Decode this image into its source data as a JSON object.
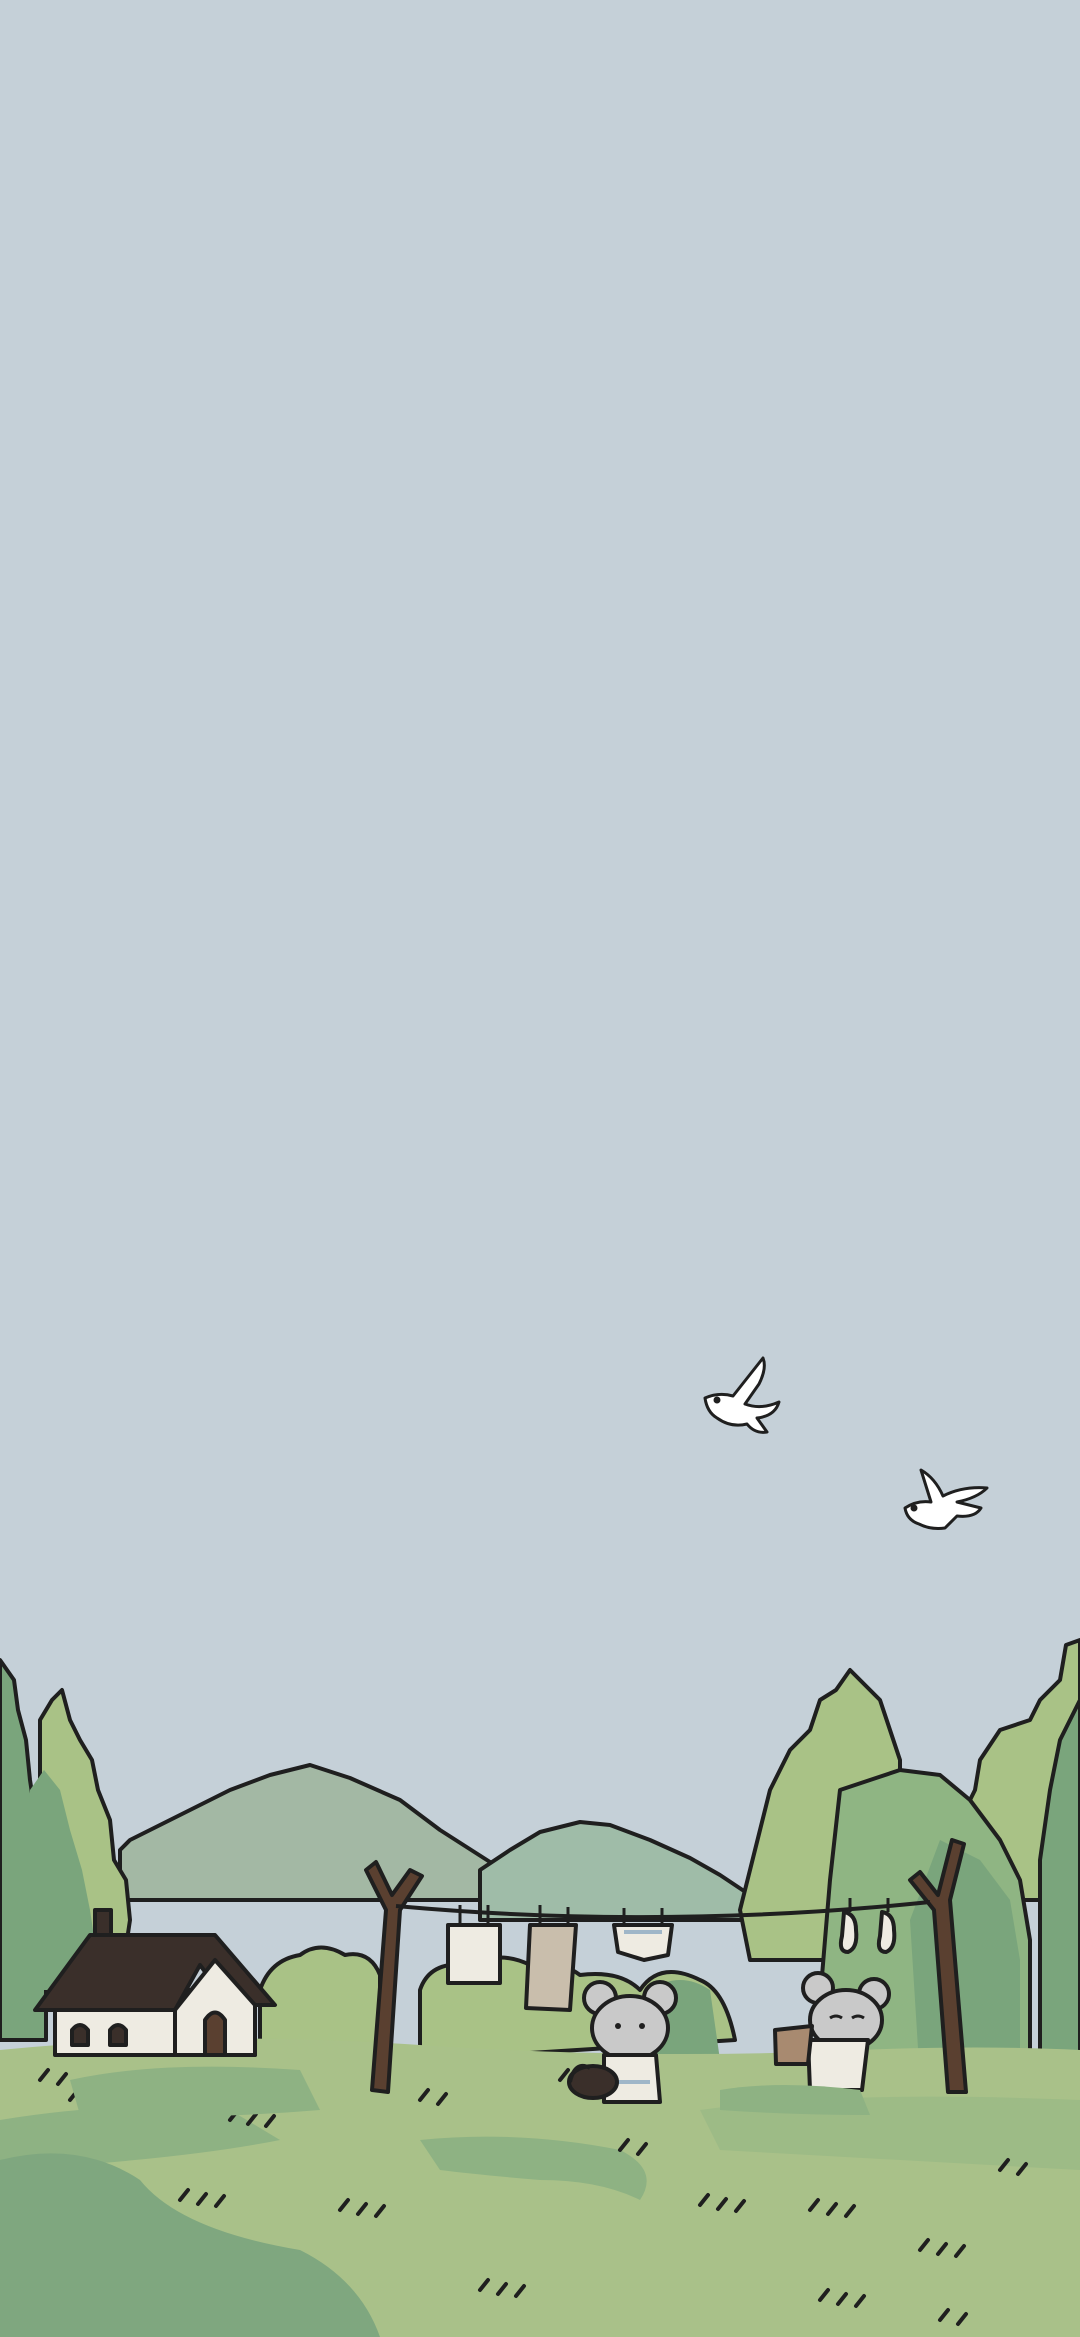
{
  "scene": {
    "kind": "illustrated-wallpaper",
    "colors": {
      "sky": "#c5d0d8",
      "mountain_back": "#a3b8a4",
      "mountain_front": "#9fbca8",
      "tree_dark": "#7aa57c",
      "tree_light": "#a9c286",
      "grass": "#a9c189",
      "grass_dark": "#7fa77f",
      "outline": "#1f1f1f",
      "roof": "#3a2f2a",
      "house_wall": "#eeebe2",
      "pole": "#5a4030",
      "mouse": "#c9c9c9",
      "bird": "#ffffff"
    },
    "elements": [
      "sky",
      "bird",
      "bird",
      "mountains",
      "trees",
      "house",
      "clothesline",
      "laundry",
      "mouse",
      "mouse",
      "meadow"
    ]
  }
}
